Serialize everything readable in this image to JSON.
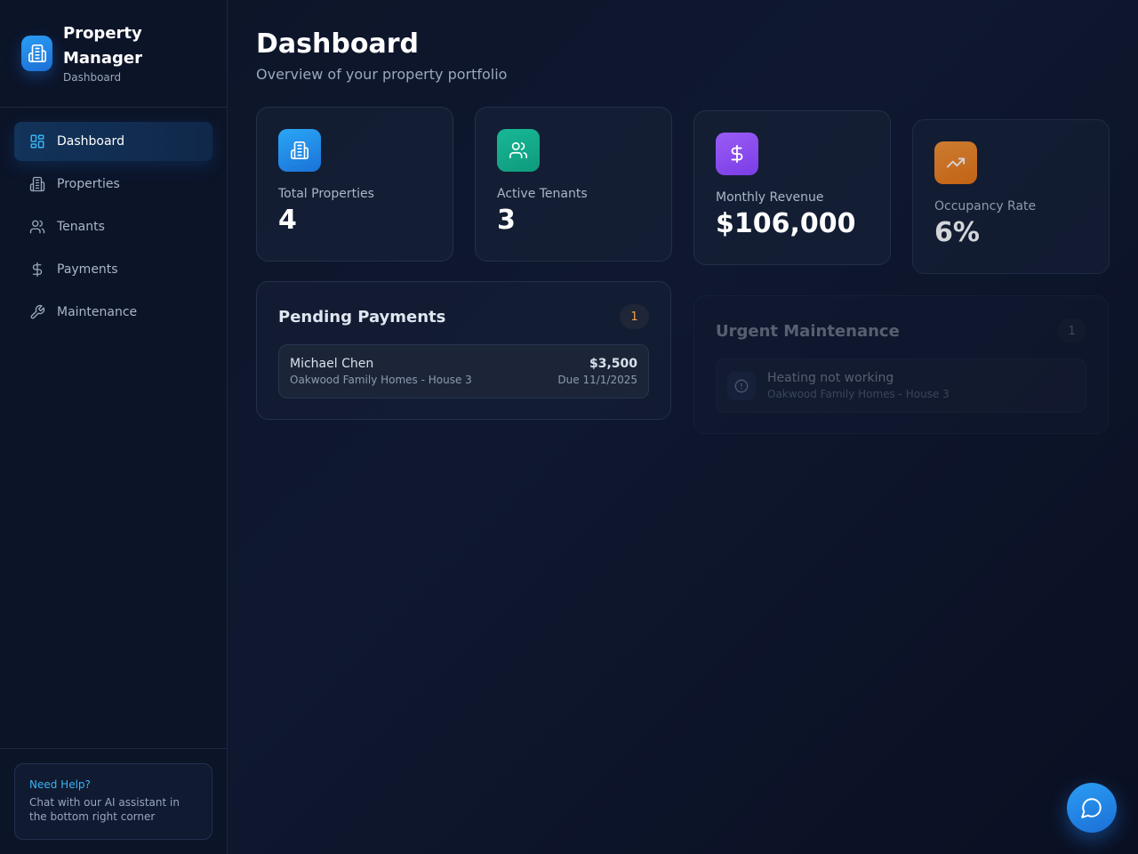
{
  "brand": {
    "title": "Property Manager",
    "subtitle": "Dashboard"
  },
  "nav": {
    "items": [
      {
        "label": "Dashboard",
        "icon": "grid-icon",
        "active": true
      },
      {
        "label": "Properties",
        "icon": "building-icon",
        "active": false
      },
      {
        "label": "Tenants",
        "icon": "users-icon",
        "active": false
      },
      {
        "label": "Payments",
        "icon": "dollar-icon",
        "active": false
      },
      {
        "label": "Maintenance",
        "icon": "wrench-icon",
        "active": false
      }
    ]
  },
  "help": {
    "title": "Need Help?",
    "text": "Chat with our AI assistant in the bottom right corner"
  },
  "header": {
    "title": "Dashboard",
    "subtitle": "Overview of your property portfolio"
  },
  "stats": [
    {
      "label": "Total Properties",
      "value": "4",
      "icon": "building-icon",
      "color": "#2a9df4"
    },
    {
      "label": "Active Tenants",
      "value": "3",
      "icon": "users-icon",
      "color": "#14a88a"
    },
    {
      "label": "Monthly Revenue",
      "value": "$106,000",
      "icon": "dollar-icon",
      "color": "#8b4cf0"
    },
    {
      "label": "Occupancy Rate",
      "value": "6%",
      "icon": "trending-up-icon",
      "color": "#f2821a"
    }
  ],
  "pending_payments": {
    "title": "Pending Payments",
    "count": "1",
    "items": [
      {
        "name": "Michael Chen",
        "property": "Oakwood Family Homes - House 3",
        "amount": "$3,500",
        "due": "Due 11/1/2025"
      }
    ]
  },
  "urgent_maintenance": {
    "title": "Urgent Maintenance",
    "count": "1",
    "items": [
      {
        "issue": "Heating not working",
        "property": "Oakwood Family Homes - House 3",
        "icon": "alert-circle-icon"
      }
    ]
  },
  "chat": {
    "icon": "chat-bubble-icon"
  },
  "colors": {
    "accent": "#2a9df4",
    "badge_pending": "#f0a04b"
  }
}
